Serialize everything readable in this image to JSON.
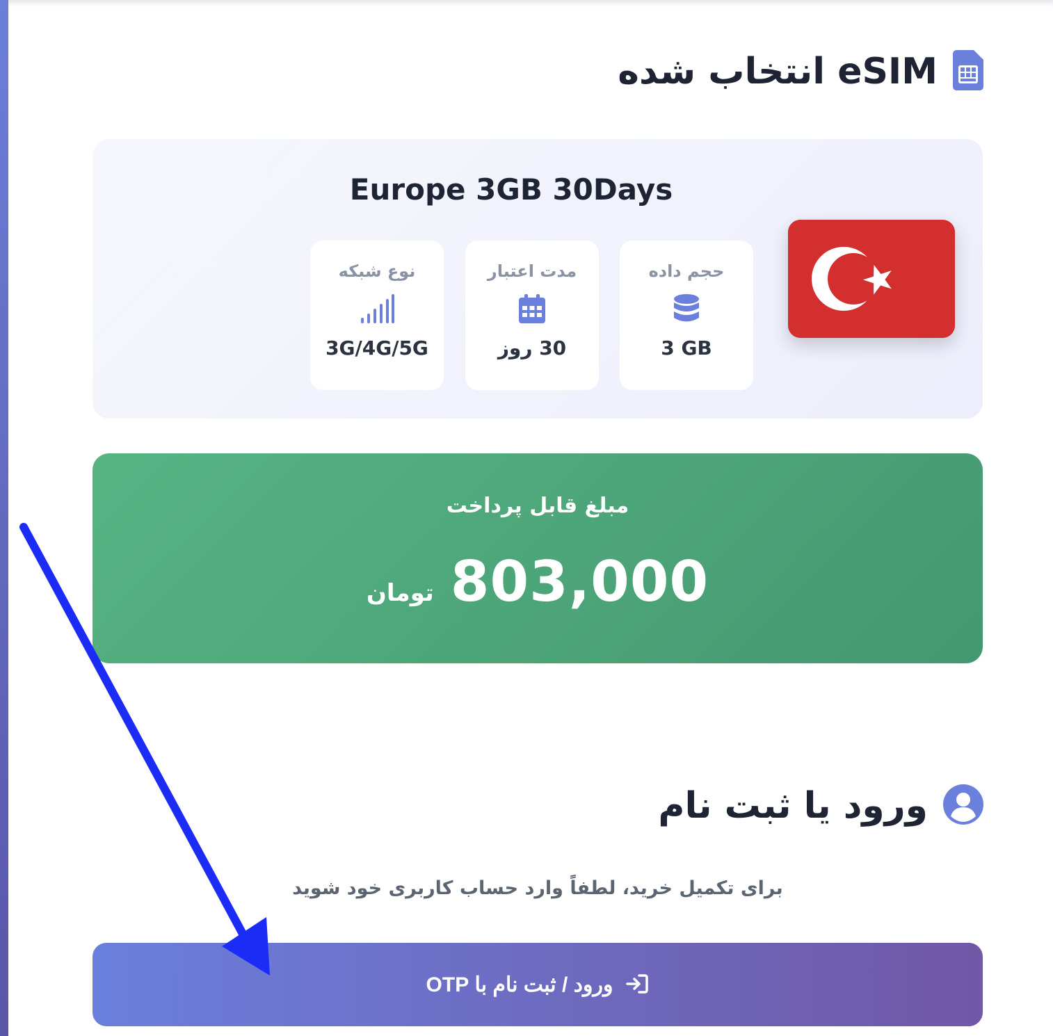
{
  "selected_section": {
    "title": "eSIM انتخاب شده",
    "icon": "sim-card-icon"
  },
  "product": {
    "name": "Europe 3GB 30Days",
    "flag": "turkey-flag",
    "specs": [
      {
        "label": "حجم داده",
        "value": "3 GB",
        "icon": "database-icon"
      },
      {
        "label": "مدت اعتبار",
        "value": "30 روز",
        "icon": "calendar-icon"
      },
      {
        "label": "نوع شبکه",
        "value": "3G/4G/5G",
        "icon": "signal-bars-icon"
      }
    ]
  },
  "price": {
    "label": "مبلغ قابل پرداخت",
    "amount": "803,000",
    "currency": "تومان"
  },
  "login_section": {
    "title": "ورود یا ثبت نام",
    "icon": "user-circle-icon",
    "description": "برای تکمیل خرید، لطفاً وارد حساب کاربری خود شوید",
    "button_label": "ورود / ثبت نام با OTP",
    "button_icon": "sign-in-icon"
  },
  "colors": {
    "accent": "#6b7fdc",
    "price_green": "#4fa97a",
    "button_gradient_end": "#7058a6",
    "annotation_arrow": "#1a2cf5"
  }
}
